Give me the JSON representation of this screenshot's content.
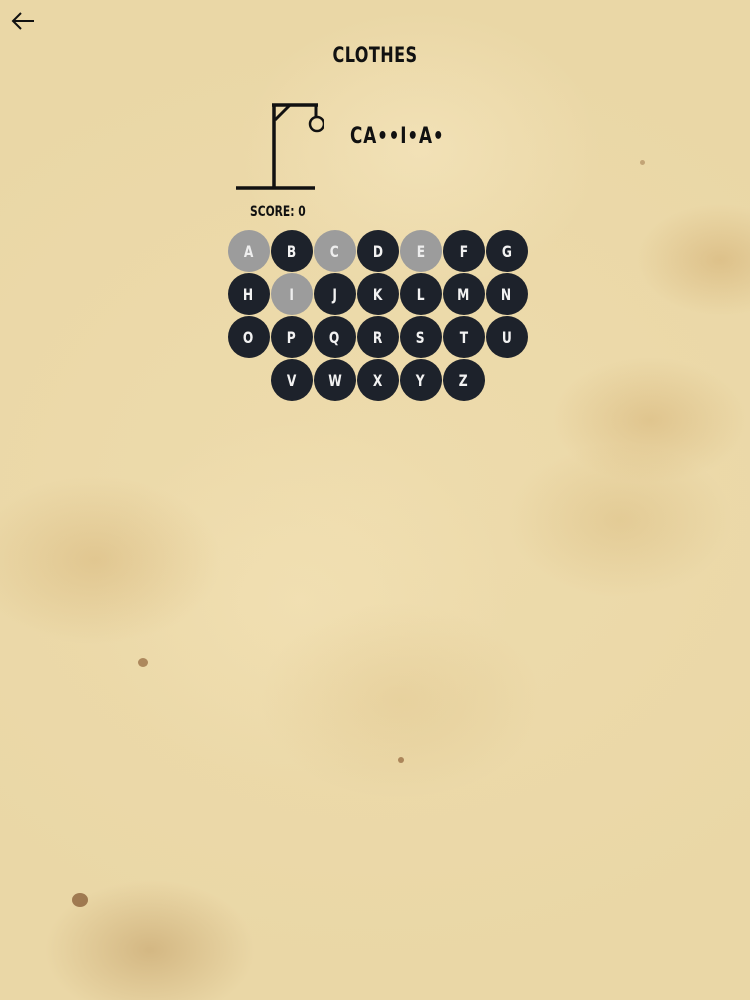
{
  "header": {
    "back_icon": "arrow-left-icon",
    "category": "CLOTHES"
  },
  "game": {
    "word_progress": "CA••I•A•",
    "score_label": "SCORE:",
    "score_value": "0",
    "gallows_icon": "gallows-icon"
  },
  "keyboard": {
    "rows": [
      [
        "A",
        "B",
        "C",
        "D",
        "E",
        "F",
        "G"
      ],
      [
        "H",
        "I",
        "J",
        "K",
        "L",
        "M",
        "N"
      ],
      [
        "O",
        "P",
        "Q",
        "R",
        "S",
        "T",
        "U"
      ],
      [
        "V",
        "W",
        "X",
        "Y",
        "Z"
      ]
    ],
    "used": [
      "A",
      "C",
      "E",
      "I"
    ]
  },
  "colors": {
    "letter_active": "#1d222b",
    "letter_used": "#9c9c9c",
    "text": "#111111",
    "paper": "#ead7a6"
  }
}
